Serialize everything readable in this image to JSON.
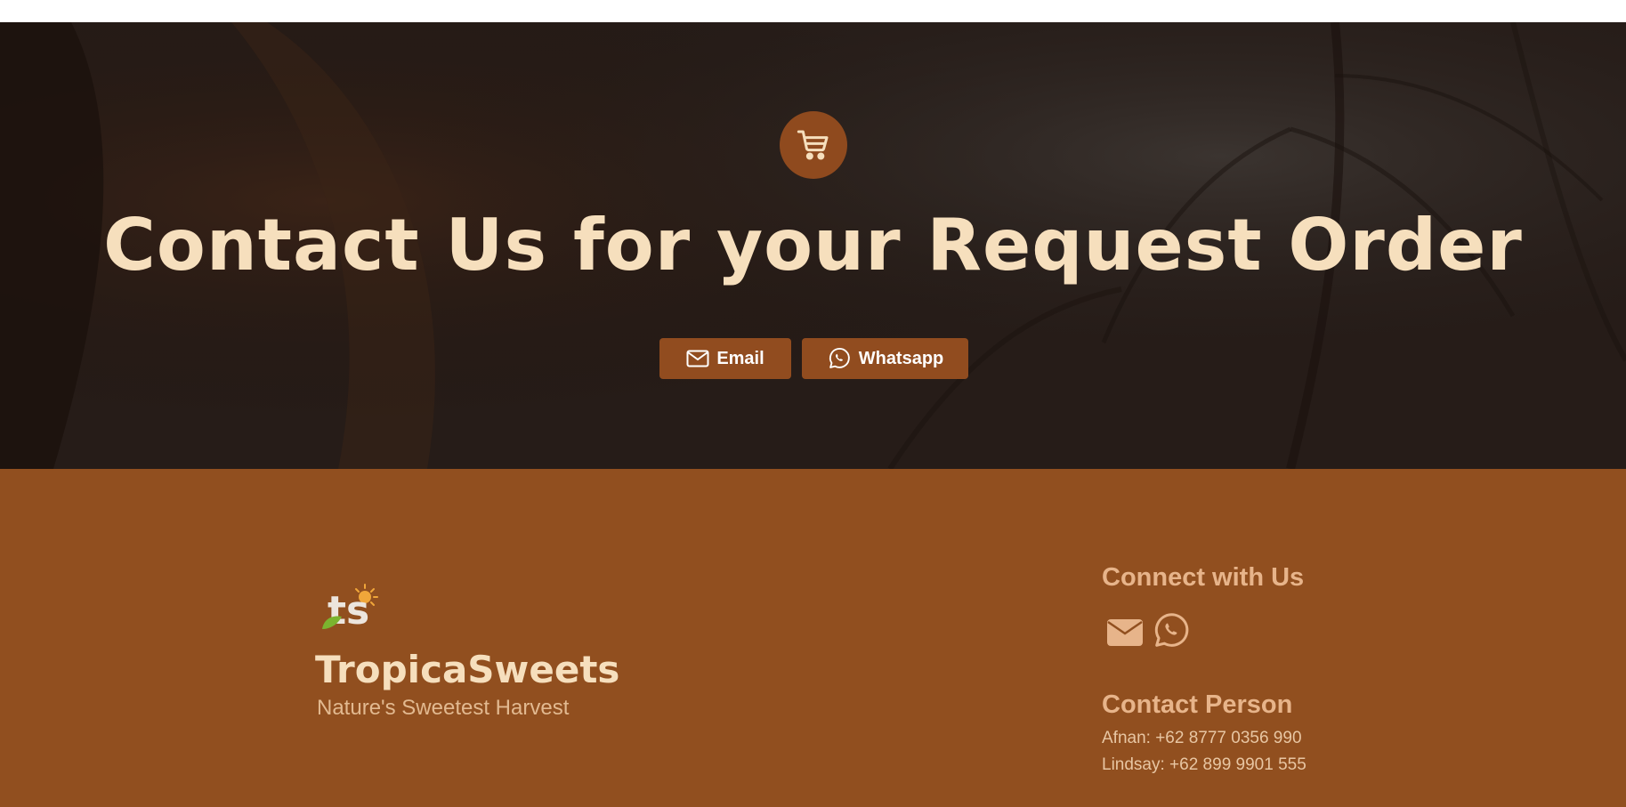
{
  "hero": {
    "icon": "shopping-cart-icon",
    "title": "Contact Us for your Request Order",
    "buttons": [
      {
        "label": "Email",
        "icon": "envelope-icon"
      },
      {
        "label": "Whatsapp",
        "icon": "whatsapp-icon"
      }
    ]
  },
  "footer": {
    "logo_text": "ts",
    "brand": "TropicaSweets",
    "tagline": "Nature's Sweetest Harvest",
    "connect_title": "Connect with Us",
    "social_icons": [
      "envelope-icon",
      "whatsapp-icon"
    ],
    "contact_title": "Contact Person",
    "contacts": [
      "Afnan: +62 8777 0356 990",
      "Lindsay: +62 899 9901 555"
    ]
  },
  "colors": {
    "hero_bg": "#2b201c",
    "accent": "#914c1f",
    "footer_bg": "#914f1f",
    "title_cream": "#f6dfbd",
    "footer_heading": "#e7b48a"
  }
}
